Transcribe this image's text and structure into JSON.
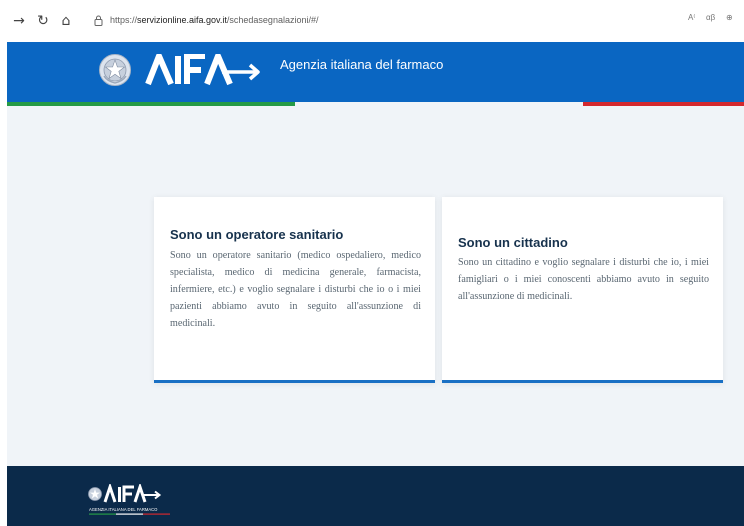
{
  "browser": {
    "url_prefix": "https://",
    "url_domain": "servizionline.aifa.gov.it",
    "url_path": "/schedasegnalazioni/#/",
    "icons": [
      "back-arrow-icon",
      "reload-icon",
      "home-icon",
      "lock-icon",
      "read-aloud-icon",
      "immersive-reader-icon",
      "zoom-icon"
    ]
  },
  "header": {
    "logo_text": "AIFA",
    "title": "Agenzia italiana del farmaco"
  },
  "cards": [
    {
      "title": "Sono un operatore sanitario",
      "text": "Sono un operatore sanitario (medico ospedaliero, medico specialista, medico di medicina generale, farmacista, infermiere, etc.) e voglio segnalare i disturbi che io o i miei pazienti abbiamo avuto in seguito all'assunzione di medicinali."
    },
    {
      "title": "Sono un cittadino",
      "text": "Sono un cittadino e voglio segnalare i disturbi che io, i miei famigliari o i miei conoscenti abbiamo avuto in seguito all'assunzione di medicinali."
    }
  ],
  "footer": {
    "logo_text": "AIFA",
    "logo_caption": "AGENZIA ITALIANA DEL FARMACO"
  },
  "colors": {
    "header_blue": "#0a66c2",
    "footer_navy": "#0b2a4a",
    "flag_green": "#259a46",
    "flag_red": "#d3282e",
    "card_accent": "#1a70c4",
    "page_bg": "#f0f4f8"
  }
}
